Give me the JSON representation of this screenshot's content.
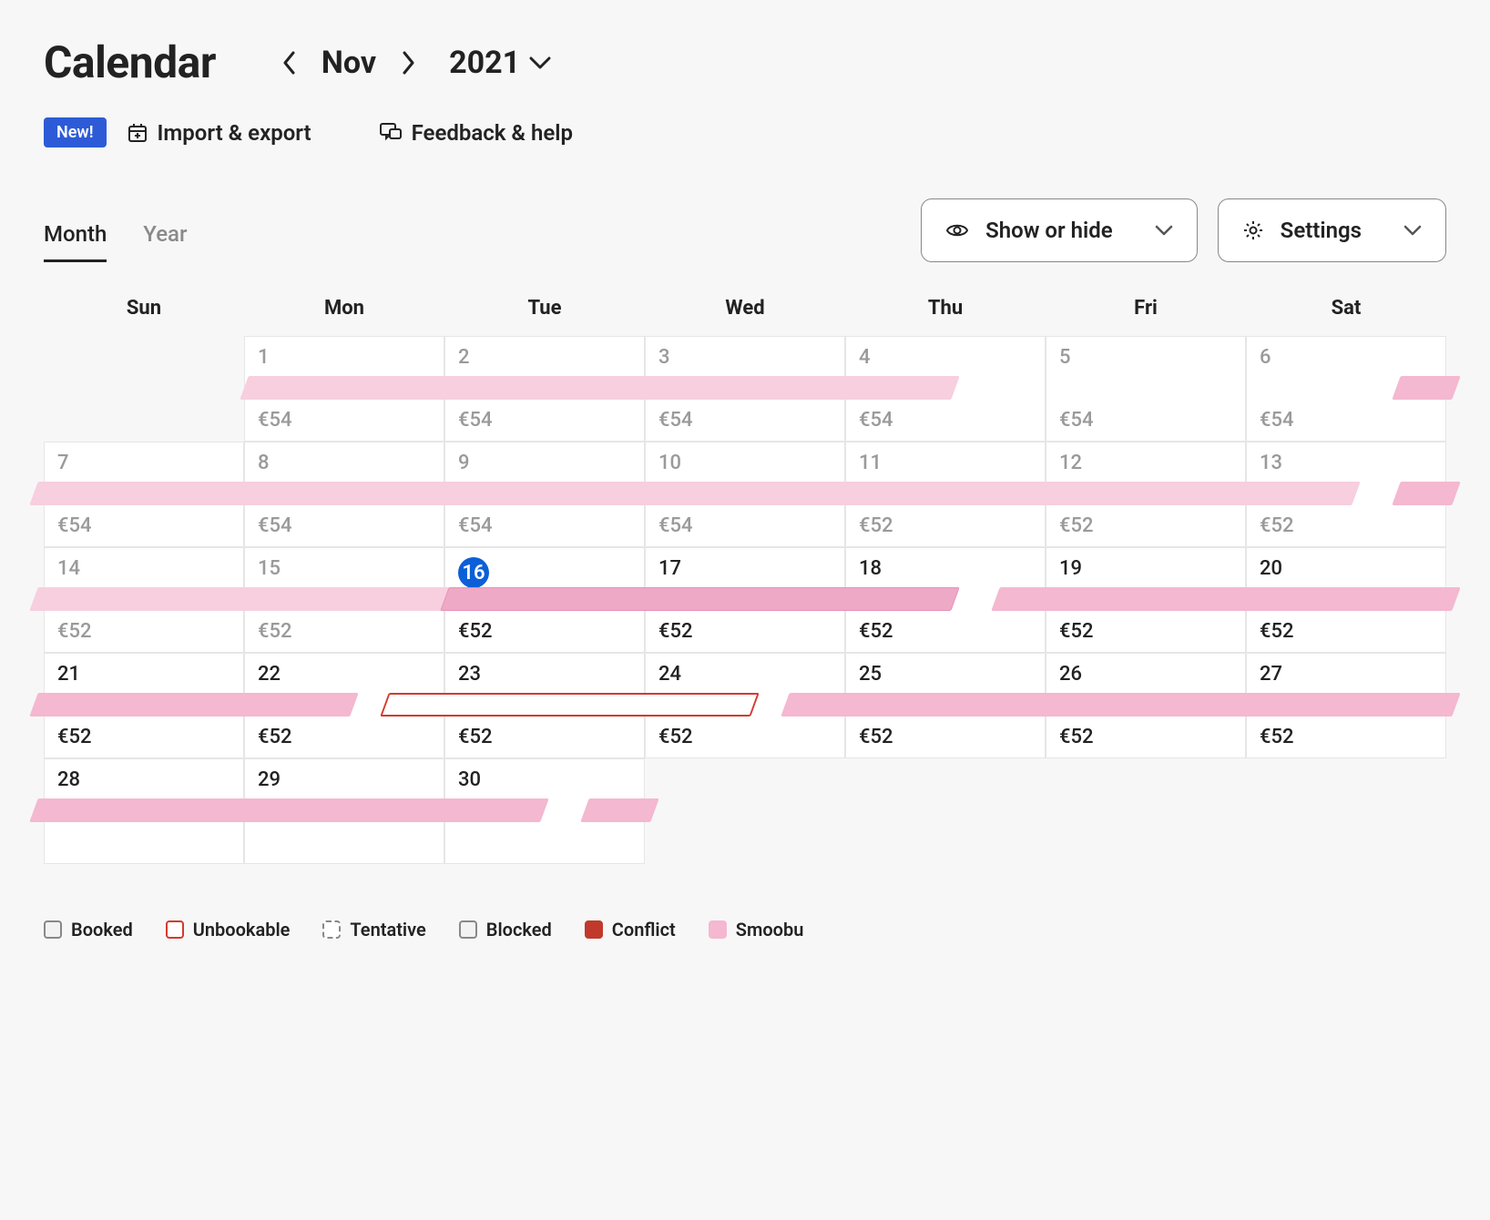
{
  "header": {
    "title": "Calendar",
    "month": "Nov",
    "year": "2021"
  },
  "toolbar": {
    "new_badge": "New!",
    "import_export": "Import & export",
    "feedback_help": "Feedback & help"
  },
  "tabs": {
    "month": "Month",
    "year": "Year",
    "active": "month"
  },
  "dropdowns": {
    "show_hide": "Show or hide",
    "settings": "Settings"
  },
  "dow": [
    "Sun",
    "Mon",
    "Tue",
    "Wed",
    "Thu",
    "Fri",
    "Sat"
  ],
  "weeks": [
    {
      "days": [
        {
          "num": "",
          "price": "",
          "empty": true
        },
        {
          "num": "1",
          "price": "€54",
          "past": true
        },
        {
          "num": "2",
          "price": "€54",
          "past": true
        },
        {
          "num": "3",
          "price": "€54",
          "past": true
        },
        {
          "num": "4",
          "price": "€54",
          "past": true
        },
        {
          "num": "5",
          "price": "€54",
          "past": true
        },
        {
          "num": "6",
          "price": "€54",
          "past": true
        }
      ],
      "bars": [
        {
          "startCol": 1,
          "endCol": 4.55,
          "cls": "light"
        },
        {
          "startCol": 6.75,
          "endCol": 7.05,
          "cls": ""
        }
      ]
    },
    {
      "days": [
        {
          "num": "7",
          "price": "€54",
          "past": true
        },
        {
          "num": "8",
          "price": "€54",
          "past": true
        },
        {
          "num": "9",
          "price": "€54",
          "past": true
        },
        {
          "num": "10",
          "price": "€54",
          "past": true
        },
        {
          "num": "11",
          "price": "€52",
          "past": true
        },
        {
          "num": "12",
          "price": "€52",
          "past": true
        },
        {
          "num": "13",
          "price": "€52",
          "past": true
        }
      ],
      "bars": [
        {
          "startCol": -0.05,
          "endCol": 6.55,
          "cls": "light"
        },
        {
          "startCol": 6.75,
          "endCol": 7.05,
          "cls": ""
        }
      ]
    },
    {
      "days": [
        {
          "num": "14",
          "price": "€52",
          "past": true
        },
        {
          "num": "15",
          "price": "€52",
          "past": true
        },
        {
          "num": "16",
          "price": "€52",
          "today": true
        },
        {
          "num": "17",
          "price": "€52"
        },
        {
          "num": "18",
          "price": "€52"
        },
        {
          "num": "19",
          "price": "€52"
        },
        {
          "num": "20",
          "price": "€52"
        }
      ],
      "bars": [
        {
          "startCol": -0.05,
          "endCol": 4.55,
          "cls": "light"
        },
        {
          "startCol": 2.0,
          "endCol": 4.55,
          "cls": "darker"
        },
        {
          "startCol": 4.75,
          "endCol": 7.05,
          "cls": ""
        }
      ]
    },
    {
      "days": [
        {
          "num": "21",
          "price": "€52"
        },
        {
          "num": "22",
          "price": "€52"
        },
        {
          "num": "23",
          "price": "€52"
        },
        {
          "num": "24",
          "price": "€52"
        },
        {
          "num": "25",
          "price": "€52"
        },
        {
          "num": "26",
          "price": "€52"
        },
        {
          "num": "27",
          "price": "€52"
        }
      ],
      "bars": [
        {
          "startCol": -0.05,
          "endCol": 1.55,
          "cls": ""
        },
        {
          "startCol": 1.7,
          "endCol": 3.55,
          "cls": "outline"
        },
        {
          "startCol": 3.7,
          "endCol": 7.05,
          "cls": ""
        }
      ]
    },
    {
      "days": [
        {
          "num": "28",
          "price": ""
        },
        {
          "num": "29",
          "price": ""
        },
        {
          "num": "30",
          "price": ""
        },
        {
          "num": "",
          "price": "",
          "empty": true
        },
        {
          "num": "",
          "price": "",
          "empty": true
        },
        {
          "num": "",
          "price": "",
          "empty": true
        },
        {
          "num": "",
          "price": "",
          "empty": true
        }
      ],
      "bars": [
        {
          "startCol": -0.05,
          "endCol": 2.5,
          "cls": ""
        },
        {
          "startCol": 2.7,
          "endCol": 3.05,
          "cls": ""
        }
      ]
    }
  ],
  "legend": {
    "booked": "Booked",
    "unbookable": "Unbookable",
    "tentative": "Tentative",
    "blocked": "Blocked",
    "conflict": "Conflict",
    "smoobu": "Smoobu"
  }
}
